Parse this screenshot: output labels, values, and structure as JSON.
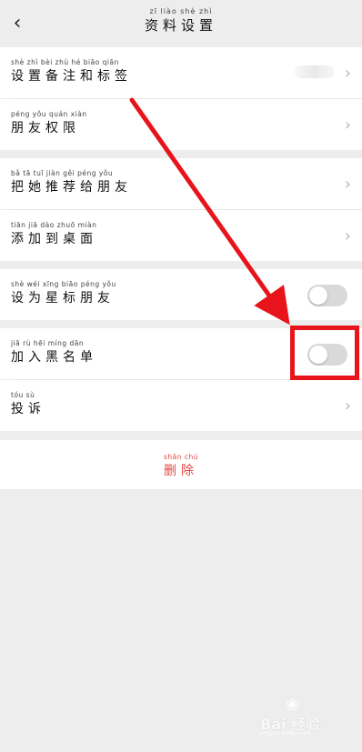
{
  "header": {
    "title_pinyin": "zī liào shè zhì",
    "title": "资料设置",
    "back_icon": "chevron-left-icon"
  },
  "sections": [
    {
      "items": [
        {
          "pinyin": "shè zhì bèi zhù hé biāo qiān",
          "label": "设置备注和标签",
          "control": "chevron"
        },
        {
          "pinyin": "péng yǒu quán xiàn",
          "label": "朋友权限",
          "control": "chevron"
        }
      ]
    },
    {
      "items": [
        {
          "pinyin": "bǎ tā tuī jiàn gěi péng yǒu",
          "label": "把她推荐给朋友",
          "control": "chevron"
        },
        {
          "pinyin": "tiān jiā dào zhuō miàn",
          "label": "添加到桌面",
          "control": "chevron"
        }
      ]
    },
    {
      "items": [
        {
          "pinyin": "shè wéi xīng biāo péng yǒu",
          "label": "设为星标朋友",
          "control": "toggle",
          "on": false
        }
      ]
    },
    {
      "items": [
        {
          "pinyin": "jiā rù hēi míng dān",
          "label": "加入黑名单",
          "control": "toggle",
          "on": false
        },
        {
          "pinyin": "tóu sù",
          "label": "投诉",
          "control": "chevron"
        }
      ]
    }
  ],
  "delete": {
    "pinyin": "shān chú",
    "label": "删除",
    "color": "#e64340"
  },
  "chevron_glyph": "›",
  "annotation": {
    "color": "#e8141b"
  },
  "watermark": {
    "brand": "Bai 经验",
    "sub": "jingyan.baidu.com"
  }
}
